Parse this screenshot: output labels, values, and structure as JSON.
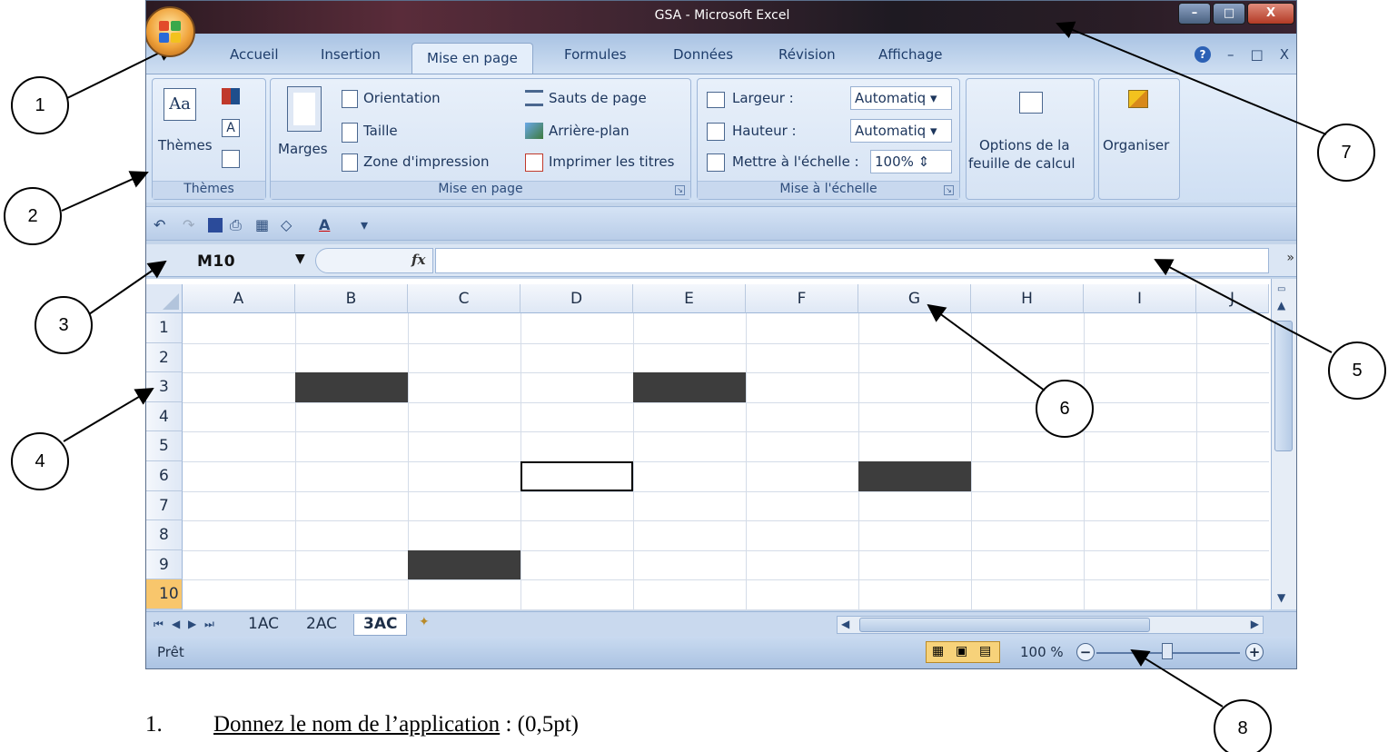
{
  "window": {
    "title": "GSA - Microsoft Excel",
    "controls": [
      "–",
      "□",
      "X"
    ]
  },
  "ribbon": {
    "tabs": [
      "Accueil",
      "Insertion",
      "Mise en page",
      "Formules",
      "Données",
      "Révision",
      "Affichage"
    ],
    "active_tab": "Mise en page",
    "help_symbol": "?",
    "doc_controls": [
      "–",
      "□",
      "X"
    ],
    "groups": {
      "themes": {
        "title": "Thèmes",
        "label": "Thèmes",
        "icon_text": "Aa"
      },
      "page_setup": {
        "title": "Mise en page",
        "margins": "Marges",
        "orientation": "Orientation",
        "size": "Taille",
        "print_area": "Zone d'impression",
        "breaks": "Sauts de page",
        "background": "Arrière-plan",
        "print_titles": "Imprimer les titres"
      },
      "scale": {
        "title": "Mise à l'échelle",
        "width_label": "Largeur :",
        "width_value": "Automatiq",
        "height_label": "Hauteur :",
        "height_value": "Automatiq",
        "scale_label": "Mettre à l'échelle :",
        "scale_value": "100%"
      },
      "sheet_options": {
        "label_line1": "Options de la",
        "label_line2": "feuille de calcul"
      },
      "arrange": {
        "label": "Organiser"
      }
    }
  },
  "quick_access": {
    "icons": [
      "undo-icon",
      "redo-icon",
      "save-icon",
      "print-preview-icon",
      "borders-icon",
      "fill-color-icon",
      "font-color-icon",
      "customize-icon"
    ],
    "font_color_letter": "A"
  },
  "formula_bar": {
    "name_box": "M10",
    "fx_label": "fx",
    "formula": "",
    "expand_symbol": "»"
  },
  "sheet": {
    "columns": [
      "A",
      "B",
      "C",
      "D",
      "E",
      "F",
      "G",
      "H",
      "I",
      "J"
    ],
    "rows": [
      "1",
      "2",
      "3",
      "4",
      "5",
      "6",
      "7",
      "8",
      "9",
      "10"
    ],
    "selected_row": "10",
    "filled_cells": [
      "B3",
      "E3",
      "G6",
      "C9"
    ],
    "outlined_cell": "D6",
    "fill_color": "#3d3d3d"
  },
  "sheet_tabs": {
    "tabs": [
      "1AC",
      "2AC",
      "3AC"
    ],
    "active": "3AC"
  },
  "status_bar": {
    "status": "Prêt",
    "zoom_text": "100 %",
    "zoom_level": 100,
    "zoom_minus": "−",
    "zoom_plus": "+"
  },
  "callouts": [
    "1",
    "2",
    "3",
    "4",
    "5",
    "6",
    "7",
    "8"
  ],
  "question": {
    "number": "1.",
    "text": "Donnez le nom de l’application",
    "points": " : (0,5pt)"
  },
  "colors": {
    "ribbon_bg": "#dbe7f6",
    "title_bar": "#3a2430",
    "selected_row_header": "#f8c66c"
  }
}
